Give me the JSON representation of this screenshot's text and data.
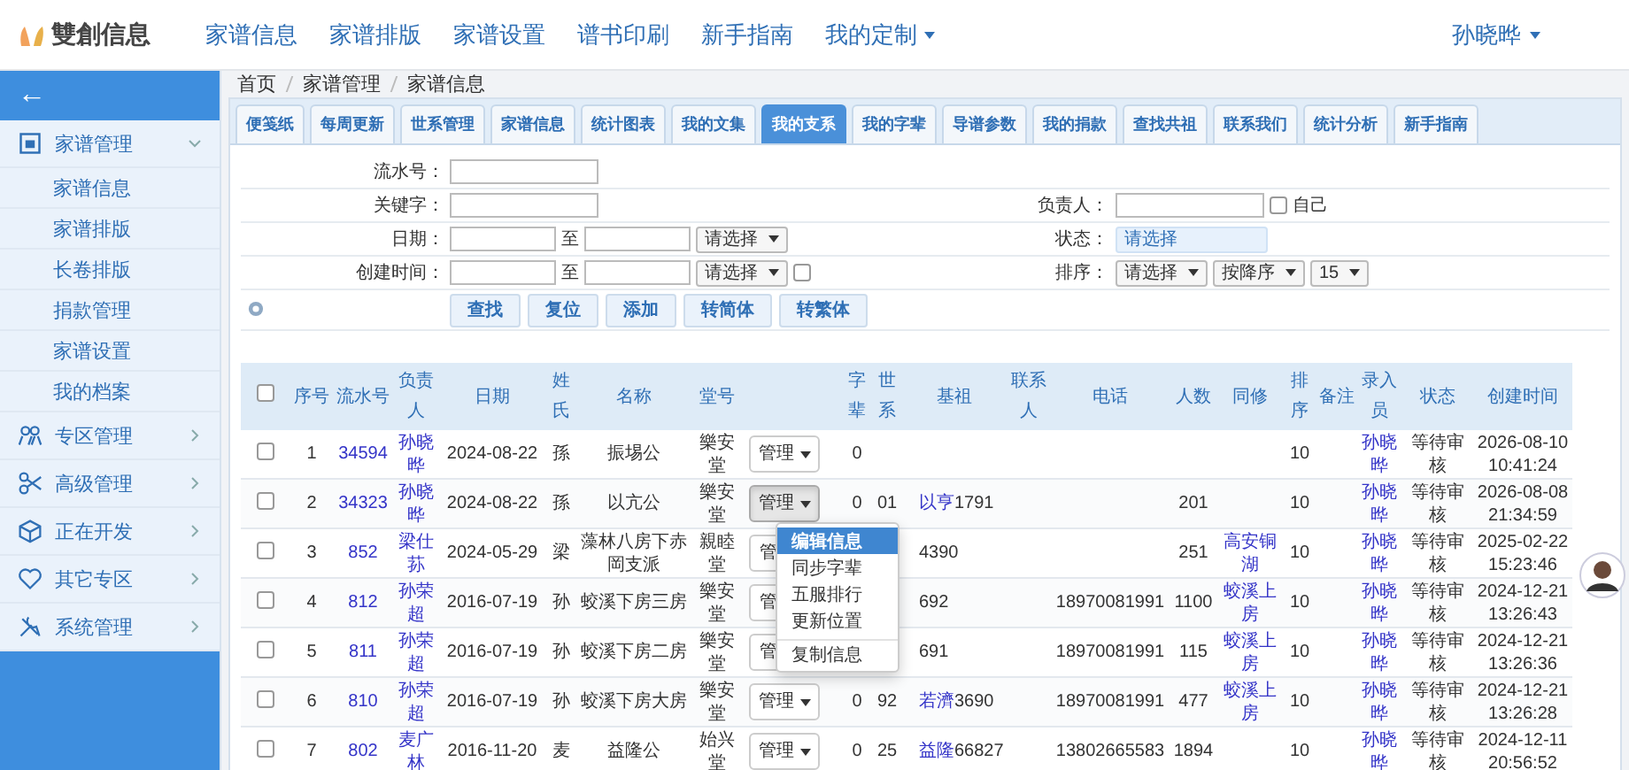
{
  "top_nav": {
    "logo_text": "雙創信息",
    "items": [
      {
        "label": "家谱信息",
        "dropdown": false
      },
      {
        "label": "家谱排版",
        "dropdown": false
      },
      {
        "label": "家谱设置",
        "dropdown": false
      },
      {
        "label": "谱书印刷",
        "dropdown": false
      },
      {
        "label": "新手指南",
        "dropdown": false
      },
      {
        "label": "我的定制",
        "dropdown": true
      }
    ],
    "user": "孙晓晔"
  },
  "sidebar": {
    "back": "←",
    "groups": [
      {
        "label": "家谱管理",
        "kind": "document",
        "expanded": true,
        "children": [
          {
            "label": "家谱信息"
          },
          {
            "label": "家谱排版"
          },
          {
            "label": "长卷排版"
          },
          {
            "label": "捐款管理"
          },
          {
            "label": "家谱设置"
          },
          {
            "label": "我的档案"
          }
        ]
      },
      {
        "label": "专区管理",
        "kind": "people",
        "expanded": false
      },
      {
        "label": "高级管理",
        "kind": "scissors",
        "expanded": false
      },
      {
        "label": "正在开发",
        "kind": "cube",
        "expanded": false
      },
      {
        "label": "其它专区",
        "kind": "heart",
        "expanded": false
      },
      {
        "label": "系统管理",
        "kind": "tools",
        "expanded": false
      }
    ]
  },
  "breadcrumb": [
    "首页",
    "家谱管理",
    "家谱信息"
  ],
  "tabs": [
    {
      "label": "便笺纸",
      "selected": false
    },
    {
      "label": "每周更新",
      "selected": false
    },
    {
      "label": "世系管理",
      "selected": false
    },
    {
      "label": "家谱信息",
      "selected": false
    },
    {
      "label": "统计图表",
      "selected": false
    },
    {
      "label": "我的文集",
      "selected": false
    },
    {
      "label": "我的支系",
      "selected": true
    },
    {
      "label": "我的字辈",
      "selected": false
    },
    {
      "label": "导谱参数",
      "selected": false
    },
    {
      "label": "我的捐款",
      "selected": false
    },
    {
      "label": "查找共祖",
      "selected": false
    },
    {
      "label": "联系我们",
      "selected": false
    },
    {
      "label": "统计分析",
      "selected": false
    },
    {
      "label": "新手指南",
      "selected": false
    }
  ],
  "filters": {
    "serial": {
      "label": "流水号："
    },
    "keyword": {
      "label": "关键字："
    },
    "owner": {
      "label": "负责人：",
      "self_label": "自己",
      "self_checked": false
    },
    "date": {
      "label": "日期：",
      "to": "至",
      "select": "请选择"
    },
    "status": {
      "label": "状态：",
      "select": "请选择"
    },
    "created": {
      "label": "创建时间：",
      "to": "至",
      "select": "请选择",
      "checked": false
    },
    "sort": {
      "label": "排序：",
      "selects": [
        "请选择",
        "按降序",
        "15"
      ]
    },
    "buttons": [
      "查找",
      "复位",
      "添加",
      "转简体",
      "转繁体"
    ]
  },
  "table": {
    "all_checked": false,
    "columns": [
      "序号",
      "流水号",
      "负责人",
      "日期",
      "姓氏",
      "名称",
      "堂号",
      "字辈",
      "世系",
      "基祖",
      "联系人",
      "电话",
      "人数",
      "同修",
      "排序",
      "备注",
      "录入员",
      "状态",
      "创建时间"
    ],
    "rows": [
      {
        "checked": false,
        "seq": "1",
        "serial": "34594",
        "owner": "孙晓晔",
        "date": "2024-08-22",
        "surname": "孫",
        "name": "振埸公",
        "hall": "樂安堂",
        "manage": {
          "label": "管理",
          "pressed": false,
          "caret": true
        },
        "zibei": "0",
        "order": "10",
        "entry": "孙晓晔",
        "status": "等待审核",
        "created": "2026-08-10 10:41:24"
      },
      {
        "checked": false,
        "seq": "2",
        "serial": "34323",
        "owner": "孙晓晔",
        "date": "2024-08-22",
        "surname": "孫",
        "name": "以亢公",
        "hall": "樂安堂",
        "manage": {
          "label": "管理",
          "pressed": true,
          "caret": true
        },
        "zibei": "0",
        "shixi": "01",
        "jizu": {
          "link": "以亨",
          "text": "1791"
        },
        "count": "201",
        "order": "10",
        "entry": "孙晓晔",
        "status": "等待审核",
        "created": "2026-08-08 21:34:59"
      },
      {
        "checked": false,
        "seq": "3",
        "serial": "852",
        "owner": "梁仕荪",
        "date": "2024-05-29",
        "surname": "梁",
        "name": "藻林八房下赤岡支派",
        "hall": "親睦堂",
        "manage": {
          "label": "管",
          "pressed": false,
          "caret": false
        },
        "jizu": {
          "text": "4390"
        },
        "count": "251",
        "tongxiu": "高安铜湖",
        "order": "10",
        "entry": "孙晓晔",
        "status": "等待审核",
        "created": "2025-02-22 15:23:46"
      },
      {
        "checked": false,
        "seq": "4",
        "serial": "812",
        "owner": "孙荣超",
        "date": "2016-07-19",
        "surname": "孙",
        "name": "蛟溪下房三房",
        "hall": "樂安堂",
        "manage": {
          "label": "管",
          "pressed": false,
          "caret": false
        },
        "jizu": {
          "text": "692"
        },
        "phone": "18970081991",
        "count": "1100",
        "tongxiu": "蛟溪上房",
        "order": "10",
        "entry": "孙晓晔",
        "status": "等待审核",
        "created": "2024-12-21 13:26:43"
      },
      {
        "checked": false,
        "seq": "5",
        "serial": "811",
        "owner": "孙荣超",
        "date": "2016-07-19",
        "surname": "孙",
        "name": "蛟溪下房二房",
        "hall": "樂安堂",
        "manage": {
          "label": "管",
          "pressed": false,
          "caret": false
        },
        "jizu": {
          "text": "691"
        },
        "phone": "18970081991",
        "count": "115",
        "tongxiu": "蛟溪上房",
        "order": "10",
        "entry": "孙晓晔",
        "status": "等待审核",
        "created": "2024-12-21 13:26:36"
      },
      {
        "checked": false,
        "seq": "6",
        "serial": "810",
        "owner": "孙荣超",
        "date": "2016-07-19",
        "surname": "孙",
        "name": "蛟溪下房大房",
        "hall": "樂安堂",
        "manage": {
          "label": "管理",
          "pressed": false,
          "caret": true
        },
        "zibei": "0",
        "shixi": "92",
        "jizu": {
          "link": "若濟",
          "text": "3690"
        },
        "phone": "18970081991",
        "count": "477",
        "tongxiu": "蛟溪上房",
        "order": "10",
        "entry": "孙晓晔",
        "status": "等待审核",
        "created": "2024-12-21 13:26:28"
      },
      {
        "checked": false,
        "seq": "7",
        "serial": "802",
        "owner": "麦广林",
        "date": "2016-11-20",
        "surname": "麦",
        "name": "益隆公",
        "hall": "始兴堂",
        "manage": {
          "label": "管理",
          "pressed": false,
          "caret": true
        },
        "zibei": "0",
        "shixi": "25",
        "jizu": {
          "link": "益隆",
          "text": "66827"
        },
        "phone": "13802665583",
        "count": "1894",
        "order": "10",
        "entry": "孙晓晔",
        "status": "等待审核",
        "created": "2024-12-11 20:56:52"
      }
    ]
  },
  "row_menu": {
    "items": [
      {
        "label": "编辑信息",
        "selected": true,
        "divider_before": false
      },
      {
        "label": "同步字辈",
        "selected": false,
        "divider_before": false
      },
      {
        "label": "五服排行",
        "selected": false,
        "divider_before": false
      },
      {
        "label": "更新位置",
        "selected": false,
        "divider_before": false
      },
      {
        "label": "复制信息",
        "selected": false,
        "divider_before": true
      }
    ]
  }
}
